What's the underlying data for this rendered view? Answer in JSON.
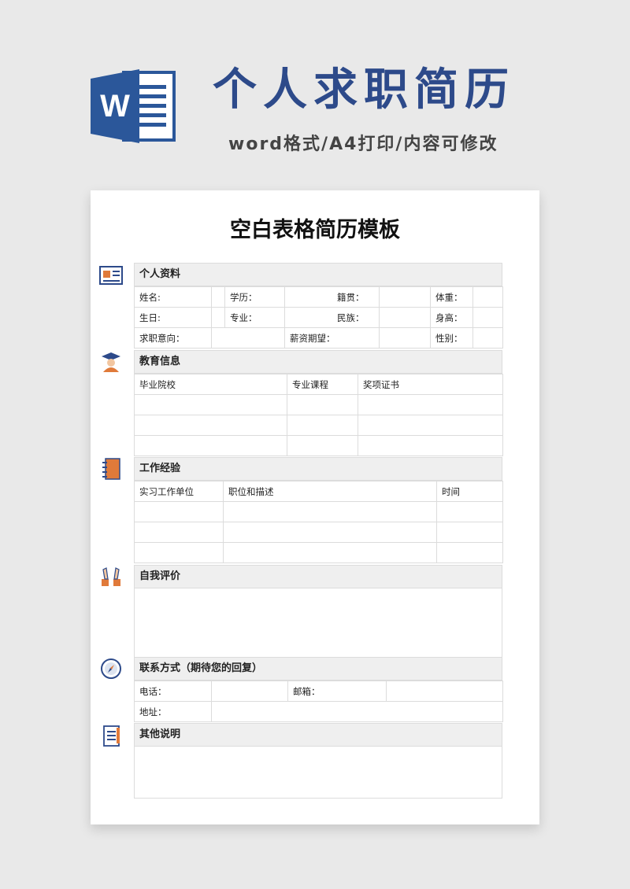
{
  "header": {
    "title": "个人求职简历",
    "subtitle": "word格式/A4打印/内容可修改",
    "logo_letter": "W"
  },
  "doc": {
    "title": "空白表格简历模板"
  },
  "sections": {
    "personal": {
      "title": "个人资料",
      "row1": [
        "姓名:",
        "学历：",
        "籍贯：",
        "体重："
      ],
      "row2": [
        "生日:",
        "专业：",
        "民族：",
        "身高："
      ],
      "row3": [
        "求职意向：",
        "薪资期望：",
        "性别："
      ]
    },
    "education": {
      "title": "教育信息",
      "columns": [
        "毕业院校",
        "专业课程",
        "奖项证书"
      ]
    },
    "work": {
      "title": "工作经验",
      "columns": [
        "实习工作单位",
        "职位和描述",
        "时间"
      ]
    },
    "self_eval": {
      "title": "自我评价"
    },
    "contact": {
      "title": "联系方式（期待您的回复）",
      "phone": "电话：",
      "email": "邮箱：",
      "address": "地址："
    },
    "other": {
      "title": "其他说明"
    }
  },
  "colors": {
    "brand_blue": "#2d4a8a",
    "word_blue": "#2b579a",
    "header_gray": "#efefef",
    "border": "#dcdcdc"
  },
  "icons": {
    "personal": "id-card-icon",
    "education": "graduate-icon",
    "work": "notebook-icon",
    "self_eval": "hands-up-icon",
    "contact": "compass-icon",
    "other": "clipboard-icon"
  }
}
